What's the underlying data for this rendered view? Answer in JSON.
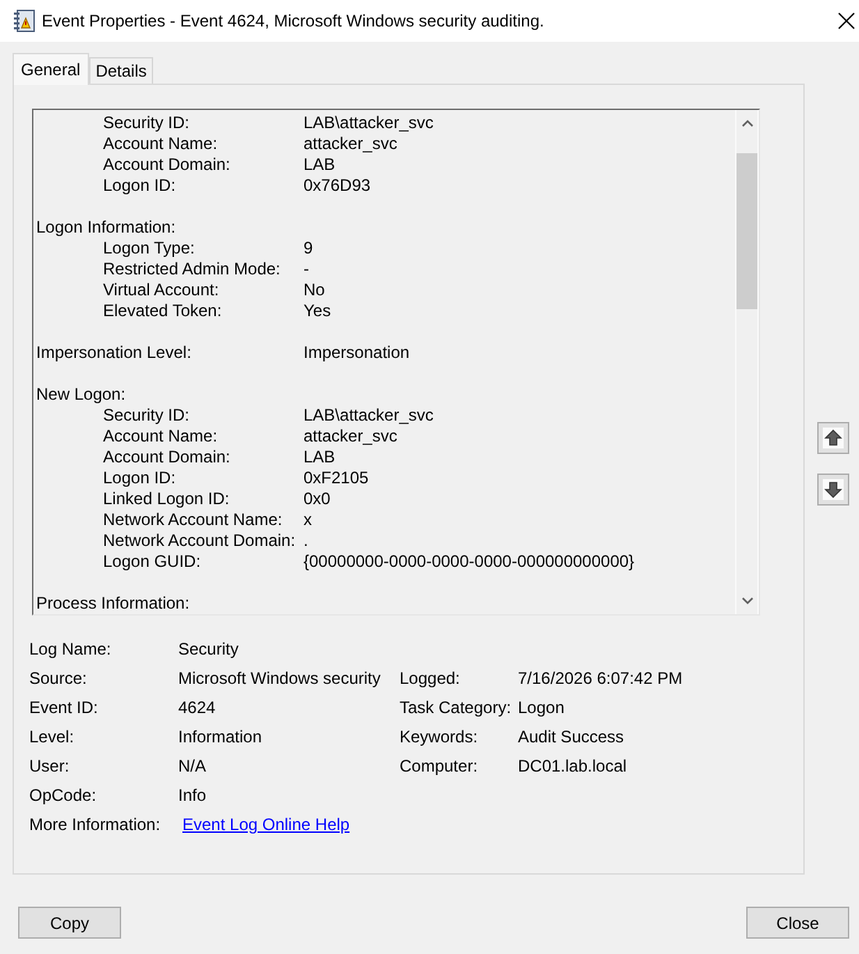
{
  "window": {
    "title": "Event Properties - Event 4624, Microsoft Windows security auditing."
  },
  "tabs": [
    {
      "label": "General",
      "selected": true
    },
    {
      "label": "Details",
      "selected": false
    }
  ],
  "description": {
    "entries": [
      {
        "kind": "group",
        "fields": [
          {
            "label": "Security ID:",
            "value": "LAB\\attacker_svc"
          },
          {
            "label": "Account Name:",
            "value": "attacker_svc"
          },
          {
            "label": "Account Domain:",
            "value": "LAB"
          },
          {
            "label": "Logon ID:",
            "value": "0x76D93"
          }
        ]
      },
      {
        "kind": "group",
        "heading": "Logon Information:",
        "fields": [
          {
            "label": "Logon Type:",
            "value": "9"
          },
          {
            "label": "Restricted Admin Mode:",
            "value": "-"
          },
          {
            "label": "Virtual Account:",
            "value": "No"
          },
          {
            "label": "Elevated Token:",
            "value": "Yes"
          }
        ]
      },
      {
        "kind": "field",
        "label": "Impersonation Level:",
        "value": "Impersonation"
      },
      {
        "kind": "group",
        "heading": "New Logon:",
        "fields": [
          {
            "label": "Security ID:",
            "value": "LAB\\attacker_svc"
          },
          {
            "label": "Account Name:",
            "value": "attacker_svc"
          },
          {
            "label": "Account Domain:",
            "value": "LAB"
          },
          {
            "label": "Logon ID:",
            "value": "0xF2105"
          },
          {
            "label": "Linked Logon ID:",
            "value": "0x0"
          },
          {
            "label": "Network Account Name:",
            "value": "x"
          },
          {
            "label": "Network Account Domain:",
            "value": "."
          },
          {
            "label": "Logon GUID:",
            "value": "{00000000-0000-0000-0000-000000000000}"
          }
        ]
      },
      {
        "kind": "group",
        "heading": "Process Information:"
      }
    ]
  },
  "summary": {
    "rows": [
      {
        "items": [
          {
            "kind": "text",
            "label": "Log Name:",
            "value": "Security"
          }
        ]
      },
      {
        "items": [
          {
            "kind": "text",
            "label": "Source:",
            "value": "Microsoft Windows security"
          },
          {
            "kind": "text",
            "label": "Logged:",
            "value": "7/16/2026 6:07:42 PM"
          }
        ]
      },
      {
        "items": [
          {
            "kind": "text",
            "label": "Event ID:",
            "value": "4624"
          },
          {
            "kind": "text",
            "label": "Task Category:",
            "value": "Logon"
          }
        ]
      },
      {
        "items": [
          {
            "kind": "text",
            "label": "Level:",
            "value": "Information"
          },
          {
            "kind": "text",
            "label": "Keywords:",
            "value": "Audit Success"
          }
        ]
      },
      {
        "items": [
          {
            "kind": "text",
            "label": "User:",
            "value": "N/A"
          },
          {
            "kind": "text",
            "label": "Computer:",
            "value": "DC01.lab.local"
          }
        ]
      },
      {
        "items": [
          {
            "kind": "text",
            "label": "OpCode:",
            "value": "Info"
          }
        ]
      },
      {
        "items": [
          {
            "kind": "link",
            "label": "More Information:",
            "value": "Event Log Online Help"
          }
        ]
      }
    ]
  },
  "buttons": [
    {
      "label": "Copy"
    },
    {
      "label": "Close"
    }
  ]
}
